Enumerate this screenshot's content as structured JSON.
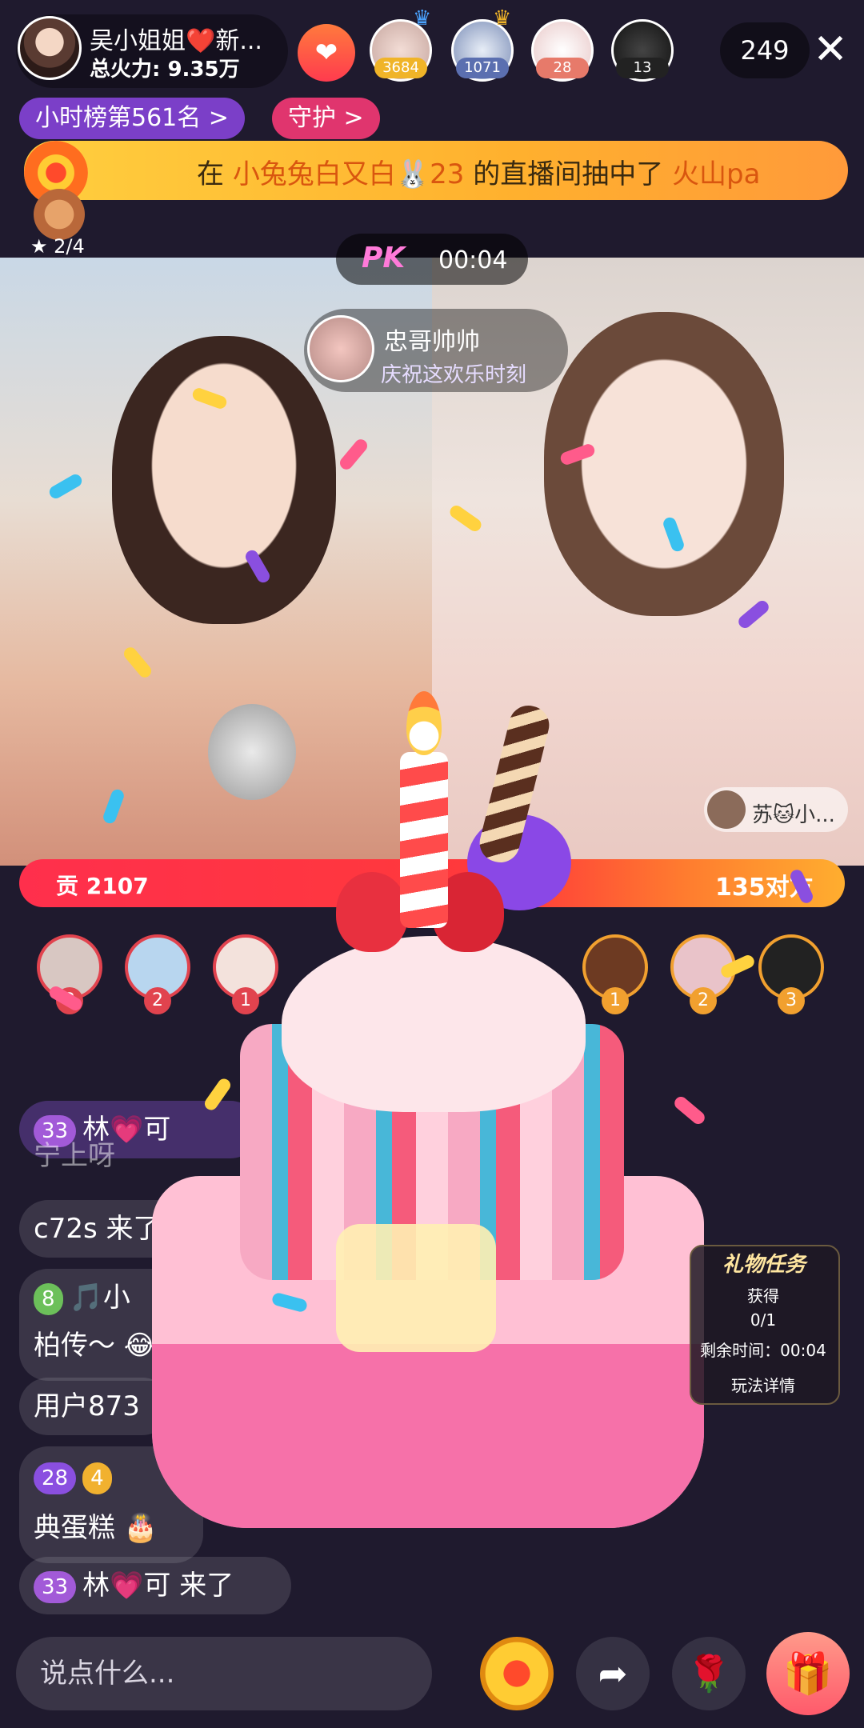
{
  "host": {
    "name": "吴小姐姐❤️新...",
    "fire_label": "总火力: 9.35万"
  },
  "viewers": [
    {
      "badge": "3684",
      "color": "#f0b428"
    },
    {
      "badge": "1071",
      "color": "#5b6fb0"
    },
    {
      "badge": "28",
      "color": "#e77a6a"
    },
    {
      "badge": "13",
      "color": "#222222"
    }
  ],
  "viewer_count": "249",
  "rank_label": "小时榜第561名 >",
  "guard_label": "守护 >",
  "banner": {
    "prefix": "在",
    "user": "小兔兔白又白🐰23",
    "suffix": "的直播间抽中了",
    "prize": "火山pa"
  },
  "stars_label": "★ 2/4",
  "pk": {
    "logo": "PK",
    "timer": "00:04",
    "our_score": "贡 2107",
    "opp_label": "135对方",
    "our_ratio": 0.94
  },
  "gift_notice": {
    "user": "忠哥帅帅",
    "message": "庆祝这欢乐时刻"
  },
  "opponent": {
    "name": "苏🐱小..."
  },
  "contributors_left": [
    "3",
    "2",
    "1"
  ],
  "contributors_right": [
    "1",
    "2",
    "3"
  ],
  "chat": [
    {
      "level": "33",
      "text": "林💗可",
      "partial": true
    },
    {
      "text": "宁上呀"
    },
    {
      "text": "c72s 来了"
    },
    {
      "level": "8",
      "text": "🎵小"
    },
    {
      "text": "柏传～ 😂"
    },
    {
      "text": "用户873"
    },
    {
      "level": "28",
      "level2": "4",
      "text": ""
    },
    {
      "text": "典蛋糕 🎂"
    },
    {
      "level": "33",
      "text": "林💗可 来了"
    }
  ],
  "gift_task": {
    "title": "礼物任务",
    "get_label": "获得",
    "progress": "0/1",
    "remaining": "剩余时间：00:04",
    "details": "玩法详情"
  },
  "input_placeholder": "说点什么...",
  "icons": [
    "share-icon",
    "rose-icon",
    "gift-icon",
    "close-icon"
  ]
}
